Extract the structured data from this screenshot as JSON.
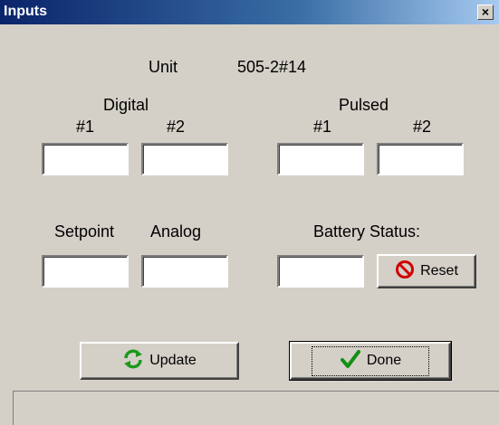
{
  "window": {
    "title": "Inputs",
    "close_label": "×"
  },
  "unit": {
    "label": "Unit",
    "value": "505-2#14"
  },
  "digital": {
    "label": "Digital",
    "ch1": "#1",
    "ch2": "#2",
    "ch1_value": "",
    "ch2_value": ""
  },
  "pulsed": {
    "label": "Pulsed",
    "ch1": "#1",
    "ch2": "#2",
    "ch1_value": "",
    "ch2_value": ""
  },
  "setpoint": {
    "label": "Setpoint",
    "value": ""
  },
  "analog": {
    "label": "Analog",
    "value": ""
  },
  "battery": {
    "label": "Battery Status:",
    "value": ""
  },
  "buttons": {
    "reset": "Reset",
    "update": "Update",
    "done": "Done"
  },
  "icons": {
    "reset": "no-entry-icon",
    "update": "refresh-icon",
    "done": "checkmark-icon"
  },
  "colors": {
    "title_gradient_start": "#0a246a",
    "title_gradient_end": "#a6caf0",
    "face": "#d4d0c8"
  }
}
